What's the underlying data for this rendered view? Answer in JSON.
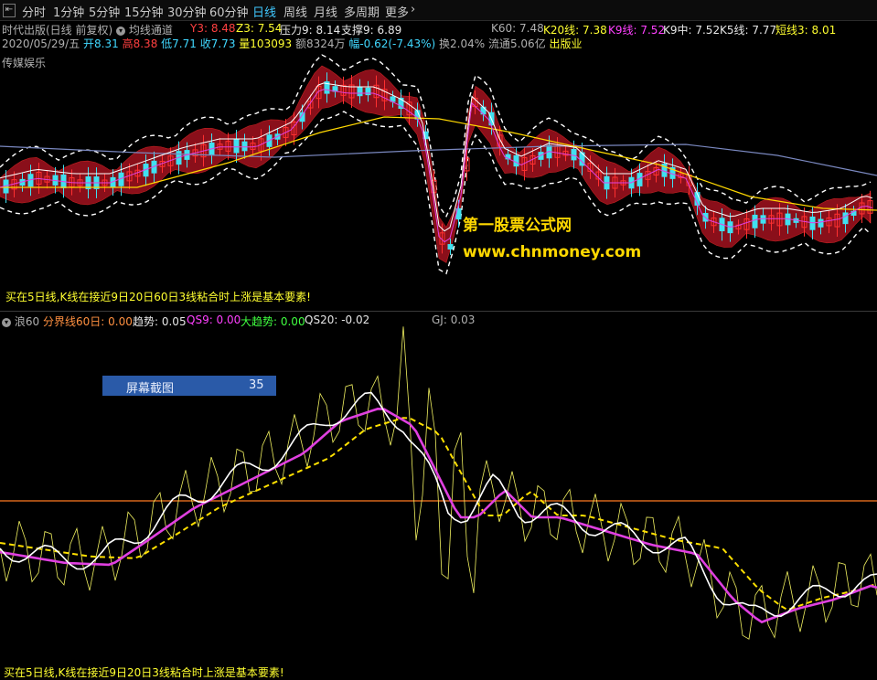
{
  "toolbar": {
    "nav_icon": "collapse-arrow-icon",
    "tabs": [
      "分时",
      "1分钟",
      "5分钟",
      "15分钟",
      "30分钟",
      "60分钟",
      "日线",
      "周线",
      "月线",
      "多周期",
      "更多"
    ],
    "active_tab": "日线",
    "more_icon": "chevron-right-icon"
  },
  "main_chart": {
    "title": "时代出版(日线 前复权)",
    "indicator": "均线通道",
    "y3": "Y3: 8.48",
    "z3": "Z3: 7.54",
    "pressure": "压力9: 8.14",
    "support": "支撑9: 6.89",
    "k60": "K60: 7.48",
    "k20": "K20线: 7.38",
    "k9": "K9线: 7.52",
    "k9mid": "K9中: 7.52",
    "k5": "K5线: 7.77",
    "short": "短线3: 8.01",
    "date": "2020/05/29/五",
    "open": "开8.31",
    "high": "高8.38",
    "low": "低7.71",
    "close": "收7.73",
    "volume": "量103093",
    "amount": "额8324万",
    "change": "幅-0.62(-7.43%)",
    "turnover": "换2.04%",
    "float": "流通5.06亿",
    "industry": "出版业",
    "sector": "传媒娱乐",
    "footer_note": "买在5日线,K线在接近9日20日60日3线粘合时上涨是基本要素!",
    "watermark_cn": "第一股票公式网",
    "watermark_url": "www.chnmoney.com"
  },
  "sub_chart": {
    "name": "浪60",
    "divider": "分界线60日: 0.00",
    "trend": "趋势: 0.05",
    "qs9": "QS9: 0.00",
    "big_trend": "大趋势: 0.00",
    "qs20": "QS20: -0.02",
    "gj": "GJ: 0.03",
    "footer_note": "买在5日线,K线在接近9日20日3线粘合时上涨是基本要素!"
  },
  "tooltip": {
    "label": "屏幕截图",
    "value": "35"
  },
  "colors": {
    "up_candle": "#ff3030",
    "down_candle": "#40e0f0",
    "channel_fill": "#8a0f1a",
    "ma_white": "#ffffff",
    "ma_yellow": "#ffd800",
    "ma_magenta": "#e040e0",
    "ma_blue": "#7a88c0",
    "divider_line": "#ff7a20",
    "active_tab": "#40c8ff"
  }
}
